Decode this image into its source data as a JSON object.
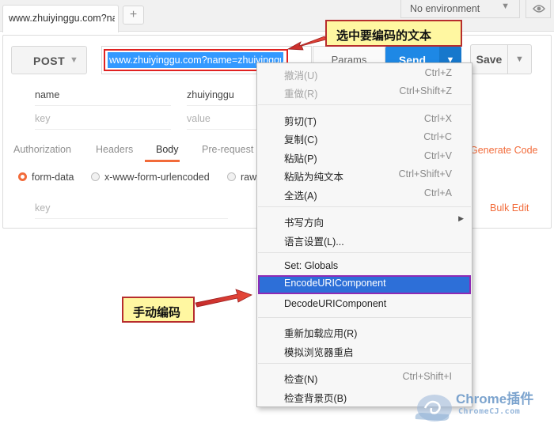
{
  "tab": {
    "title": "www.zhuiyinggu.com?na",
    "add": "+"
  },
  "environment": {
    "label": "No environment"
  },
  "request": {
    "method": "POST",
    "url_selected": "www.zhuiyinggu.com?name=zhuiyinggu",
    "params": "Params",
    "send": "Send",
    "save": "Save"
  },
  "kv": {
    "row1_key": "name",
    "row1_value": "zhuiyinggu",
    "key_placeholder": "key",
    "value_placeholder": "value"
  },
  "subtabs": [
    "Authorization",
    "Headers",
    "Body",
    "Pre-request"
  ],
  "generate_code": "Generate Code",
  "body_modes": [
    "form-data",
    "x-www-form-urlencoded",
    "raw"
  ],
  "body_key_placeholder": "key",
  "bulk_edit": "Bulk Edit",
  "context_menu": {
    "undo": {
      "label": "撤消(U)",
      "shortcut": "Ctrl+Z"
    },
    "redo": {
      "label": "重做(R)",
      "shortcut": "Ctrl+Shift+Z"
    },
    "cut": {
      "label": "剪切(T)",
      "shortcut": "Ctrl+X"
    },
    "copy": {
      "label": "复制(C)",
      "shortcut": "Ctrl+C"
    },
    "paste": {
      "label": "粘贴(P)",
      "shortcut": "Ctrl+V"
    },
    "paste_plain": {
      "label": "粘贴为纯文本",
      "shortcut": "Ctrl+Shift+V"
    },
    "select_all": {
      "label": "全选(A)",
      "shortcut": "Ctrl+A"
    },
    "writing_direction": {
      "label": "书写方向"
    },
    "language_settings": {
      "label": "语言设置(L)..."
    },
    "set_globals": {
      "label": "Set: Globals"
    },
    "encode": {
      "label": "EncodeURIComponent"
    },
    "decode": {
      "label": "DecodeURIComponent"
    },
    "reload_app": {
      "label": "重新加载应用(R)"
    },
    "simulate_restart": {
      "label": "模拟浏览器重启"
    },
    "inspect": {
      "label": "检查(N)",
      "shortcut": "Ctrl+Shift+I"
    },
    "inspect_bg": {
      "label": "检查背景页(B)"
    }
  },
  "callouts": {
    "select_text": "选中要编码的文本",
    "manual_encode": "手动编码"
  },
  "watermark": {
    "brand": "Chrome插件",
    "site": "ChromeCJ.com"
  },
  "colors": {
    "accent": "#f26b3a",
    "send_blue": "#1e88e5",
    "menu_highlight": "#2d6fd8",
    "callout_fill": "#fff7a1",
    "callout_border": "#b72d2d"
  }
}
